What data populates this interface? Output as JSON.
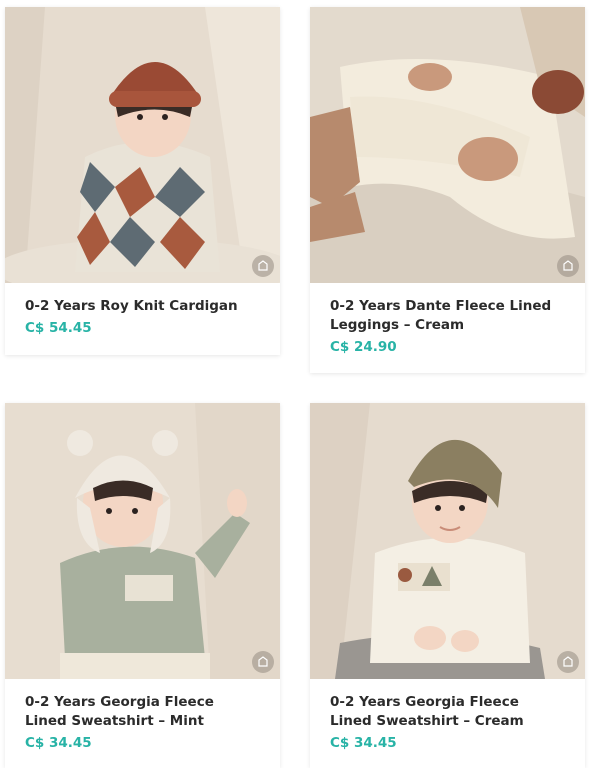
{
  "products": [
    {
      "title": "0-2 Years Roy Knit Cardigan",
      "price": "C$ 54.45",
      "image_icon": "baby-knit-cardigan-photo"
    },
    {
      "title": "0-2 Years Dante Fleece Lined Leggings – Cream",
      "price": "C$ 24.90",
      "image_icon": "baby-fleece-leggings-photo"
    },
    {
      "title": "0-2 Years Georgia Fleece Lined Sweatshirt – Mint",
      "price": "C$ 34.45",
      "image_icon": "baby-mint-sweatshirt-photo"
    },
    {
      "title": "0-2 Years Georgia Fleece Lined Sweatshirt – Cream",
      "price": "C$ 34.45",
      "image_icon": "baby-cream-sweatshirt-photo"
    }
  ],
  "colors": {
    "price": "#28b3a6",
    "title": "#2b2b2b",
    "backdrop": "#e7ded2"
  }
}
